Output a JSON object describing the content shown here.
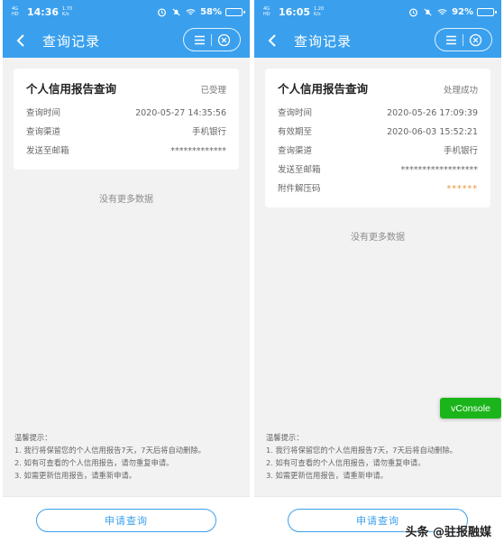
{
  "screens": [
    {
      "status": {
        "net_top": "4G",
        "net_bottom": "HD",
        "time": "14:36",
        "speed_value": "1.70",
        "speed_unit": "K/s",
        "battery_pct": "58%",
        "battery_level": 0.58
      },
      "nav": {
        "title": "查询记录"
      },
      "card": {
        "title": "个人信用报告查询",
        "status": "已受理",
        "rows": [
          {
            "label": "查询时间",
            "value": "2020-05-27 14:35:56"
          },
          {
            "label": "查询渠道",
            "value": "手机银行"
          },
          {
            "label": "发送至邮箱",
            "value": "*************"
          }
        ]
      },
      "no_more": "没有更多数据",
      "tips": [
        "温馨提示：",
        "1. 我行将保留您的个人信用报告7天，7天后将自动删除。",
        "2. 如有可查看的个人信用报告，请勿重复申请。",
        "3. 如需更新信用报告，请重新申请。"
      ],
      "apply_label": "申请查询"
    },
    {
      "status": {
        "net_top": "4G",
        "net_bottom": "HD",
        "time": "16:05",
        "speed_value": "1.20",
        "speed_unit": "K/s",
        "battery_pct": "92%",
        "battery_level": 0.92
      },
      "nav": {
        "title": "查询记录"
      },
      "card": {
        "title": "个人信用报告查询",
        "status": "处理成功",
        "rows": [
          {
            "label": "查询时间",
            "value": "2020-05-26 17:09:39"
          },
          {
            "label": "有效期至",
            "value": "2020-06-03 15:52:21"
          },
          {
            "label": "查询渠道",
            "value": "手机银行"
          },
          {
            "label": "发送至邮箱",
            "value": "******************"
          },
          {
            "label": "附件解压码",
            "value": "******"
          }
        ]
      },
      "no_more": "没有更多数据",
      "tips": [
        "温馨提示：",
        "1. 我行将保留您的个人信用报告7天，7天后将自动删除。",
        "2. 如有可查看的个人信用报告，请勿重复申请。",
        "3. 如需更新信用报告，请重新申请。"
      ],
      "apply_label": "申请查询"
    }
  ],
  "vconsole_label": "vConsole",
  "watermark": "头条 @驻报融媒",
  "colors": {
    "primary": "#3aa0ee",
    "vconsole": "#1bb51b",
    "accent_orange": "#e8953c"
  }
}
